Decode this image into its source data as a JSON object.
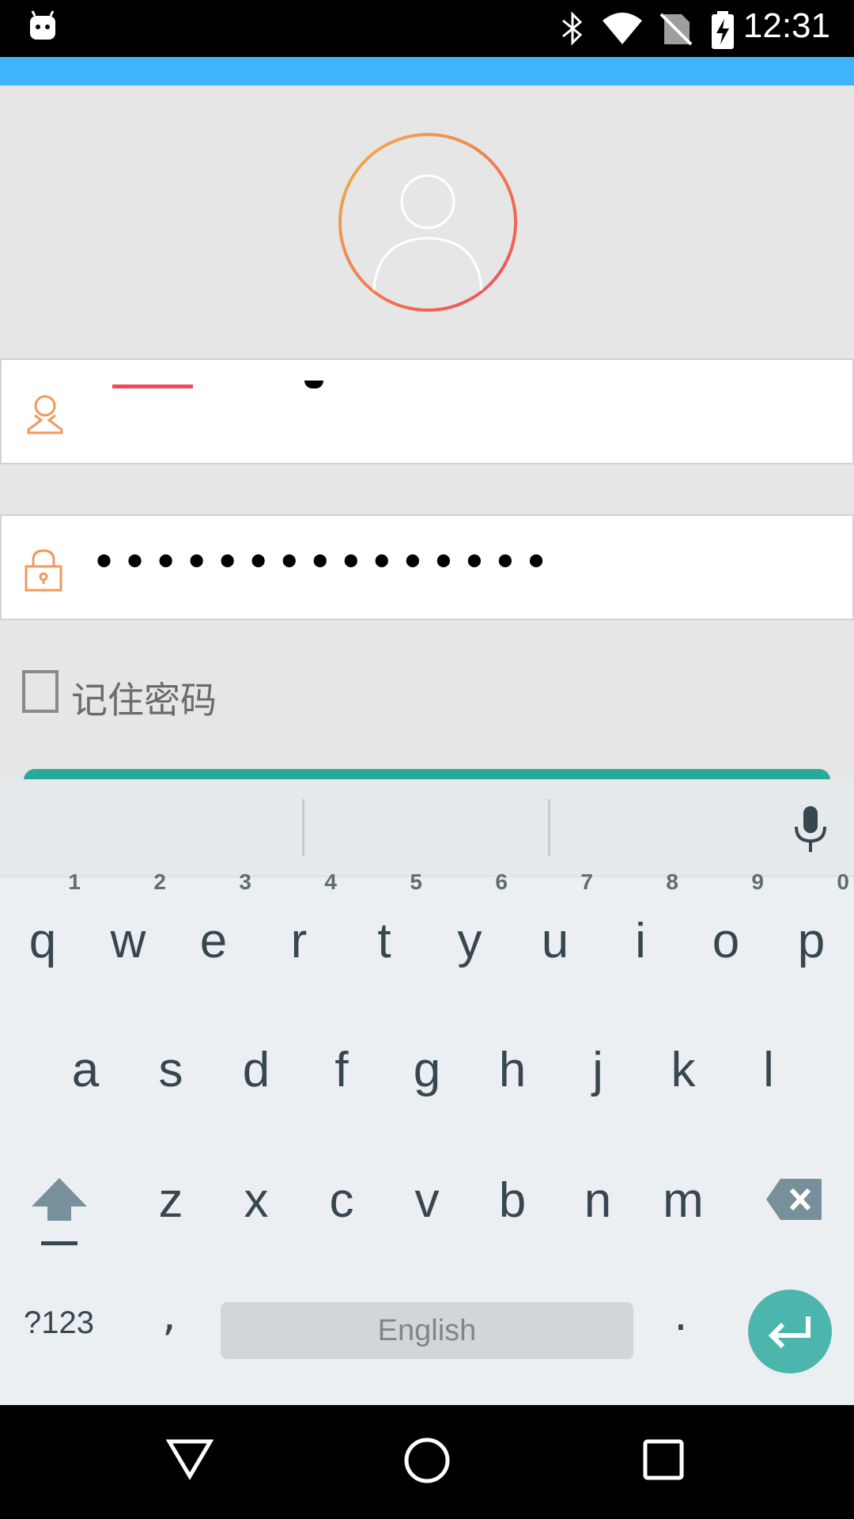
{
  "status_bar": {
    "time": "12:31"
  },
  "login": {
    "password_mask": "•••••••••••••••",
    "remember_label": "记住密码"
  },
  "keyboard": {
    "row1": [
      {
        "char": "q",
        "hint": "1"
      },
      {
        "char": "w",
        "hint": "2"
      },
      {
        "char": "e",
        "hint": "3"
      },
      {
        "char": "r",
        "hint": "4"
      },
      {
        "char": "t",
        "hint": "5"
      },
      {
        "char": "y",
        "hint": "6"
      },
      {
        "char": "u",
        "hint": "7"
      },
      {
        "char": "i",
        "hint": "8"
      },
      {
        "char": "o",
        "hint": "9"
      },
      {
        "char": "p",
        "hint": "0"
      }
    ],
    "row2": [
      "a",
      "s",
      "d",
      "f",
      "g",
      "h",
      "j",
      "k",
      "l"
    ],
    "row3": [
      "z",
      "x",
      "c",
      "v",
      "b",
      "n",
      "m"
    ],
    "symbols_label": "?123",
    "comma": ",",
    "period": ".",
    "space_label": "English"
  },
  "colors": {
    "accent_strip": "#3fb4fd",
    "login_button": "#2aa89a",
    "enter_key": "#4db6ac",
    "icon_orange": "#f0995c"
  }
}
